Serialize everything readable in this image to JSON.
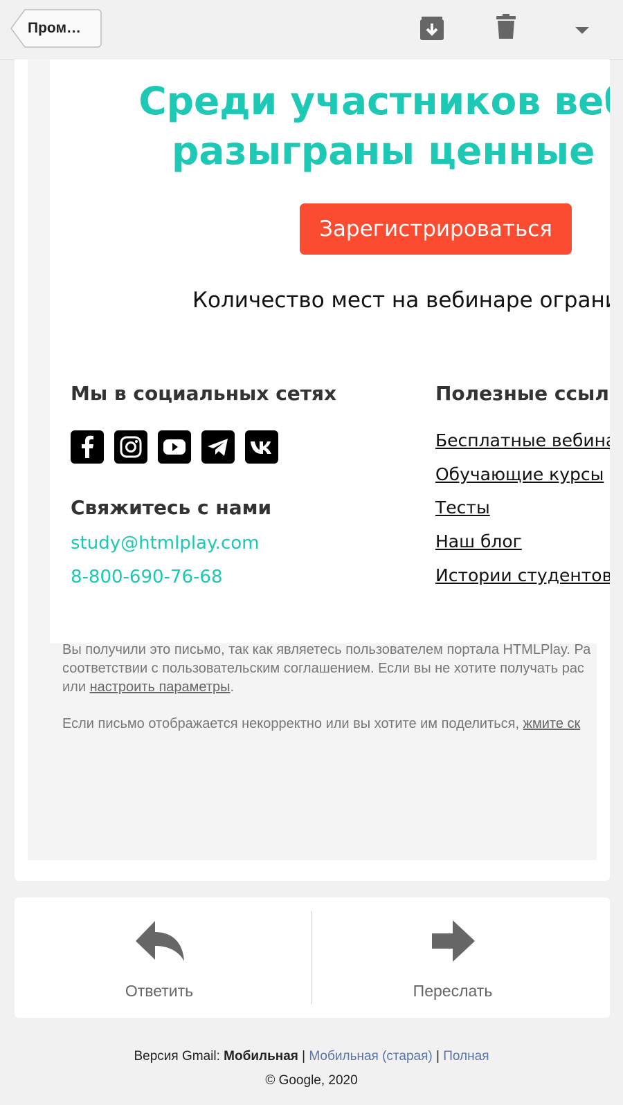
{
  "toolbar": {
    "back_label": "Пром…",
    "archive_icon": "archive-icon",
    "trash_icon": "trash-icon",
    "more_icon": "chevron-down-icon"
  },
  "email": {
    "headline_line1": "Среди участников вебинар",
    "headline_line2": "разыграны ценные при",
    "register_button": "Зарегистрироваться",
    "seats_text": "Количество мест на вебинаре ограни",
    "social_heading": "Мы в социальных сетях",
    "social_icons": [
      "facebook-icon",
      "instagram-icon",
      "youtube-icon",
      "telegram-icon",
      "vk-icon"
    ],
    "contact_heading": "Свяжитесь с нами",
    "contact_email": "study@htmlplay.com",
    "contact_phone": "8-800-690-76-68",
    "links_heading": "Полезные ссылки",
    "links": [
      "Бесплатные вебинар",
      "Обучающие курсы",
      "Тесты",
      "Наш блог",
      "Истории студентов"
    ],
    "fine_print_line1": "Вы получили это письмо, так как являетесь пользователем портала HTMLPlay. Ра",
    "fine_print_line2": "соответствии с пользовательским соглашением. Если вы не хотите получать рас",
    "fine_print_line3_prefix": "или ",
    "fine_print_settings_link": "настроить параметры",
    "fine_print_line3_suffix": ".",
    "fine_print_share_prefix": "Если письмо отображается некорректно или вы хотите им поделиться, ",
    "fine_print_share_link": "жмите ск",
    "accent_color": "#1dc8b5",
    "button_color": "#fb4b31"
  },
  "actions": {
    "reply_label": "Ответить",
    "forward_label": "Переслать"
  },
  "footer": {
    "version_prefix": "Версия Gmail: ",
    "current": "Мобильная",
    "sep": " | ",
    "old_mobile": "Мобильная (старая)",
    "full": "Полная",
    "copyright": "© Google, 2020"
  }
}
